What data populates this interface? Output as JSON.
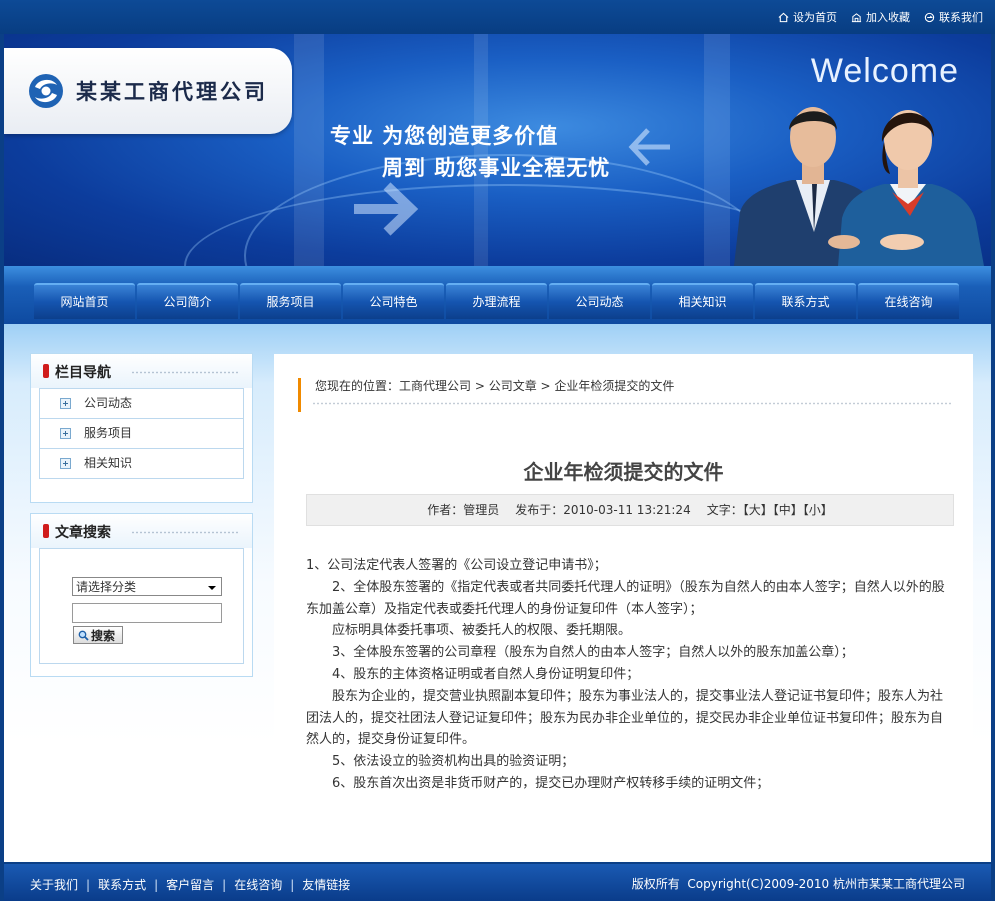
{
  "toplinks": [
    {
      "label": "设为首页",
      "icon": "home-icon"
    },
    {
      "label": "加入收藏",
      "icon": "favorite-icon"
    },
    {
      "label": "联系我们",
      "icon": "contact-icon"
    }
  ],
  "brand": {
    "company": "某某工商代理公司"
  },
  "banner": {
    "welcome": "Welcome",
    "slogan1": "专业  为您创造更多价值",
    "slogan2": "周到  助您事业全程无忧"
  },
  "nav": [
    "网站首页",
    "公司简介",
    "服务项目",
    "公司特色",
    "办理流程",
    "公司动态",
    "相关知识",
    "联系方式",
    "在线咨询"
  ],
  "sidebar": {
    "nav_title": "栏目导航",
    "categories": [
      "公司动态",
      "服务项目",
      "相关知识"
    ],
    "search_title": "文章搜索",
    "select_value": "请选择分类",
    "search_button": "搜索"
  },
  "breadcrumb": {
    "prefix": "您现在的位置：",
    "home": "工商代理公司",
    "sep1": " > ",
    "section": "公司文章",
    "sep2": " > ",
    "current": "企业年检须提交的文件"
  },
  "article": {
    "title": "企业年检须提交的文件",
    "author": "作者：管理员",
    "date": "发布于：2010-03-11 13:21:24",
    "size_label": "文字：",
    "size_large": "【大】",
    "size_medium": "【中】",
    "size_small": "【小】",
    "paragraphs": [
      "1、公司法定代表人签署的《公司设立登记申请书》；",
      "2、全体股东签署的《指定代表或者共同委托代理人的证明》（股东为自然人的由本人签字；自然人以外的股东加盖公章）及指定代表或委托代理人的身份证复印件（本人签字）；",
      "应标明具体委托事项、被委托人的权限、委托期限。",
      "3、全体股东签署的公司章程（股东为自然人的由本人签字；自然人以外的股东加盖公章）；",
      "4、股东的主体资格证明或者自然人身份证明复印件；",
      "股东为企业的，提交营业执照副本复印件；股东为事业法人的，提交事业法人登记证书复印件；股东人为社团法人的，提交社团法人登记证复印件；股东为民办非企业单位的，提交民办非企业单位证书复印件；股东为自然人的，提交身份证复印件。",
      "5、依法设立的验资机构出具的验资证明；",
      "6、股东首次出资是非货币财产的，提交已办理财产权转移手续的证明文件；"
    ]
  },
  "footer": {
    "links": [
      "关于我们",
      "联系方式",
      "客户留言",
      "在线咨询",
      "友情链接"
    ],
    "separator": "|",
    "copyright": "版权所有  Copyright(C)2009-2010 杭州市某某工商代理公司"
  }
}
